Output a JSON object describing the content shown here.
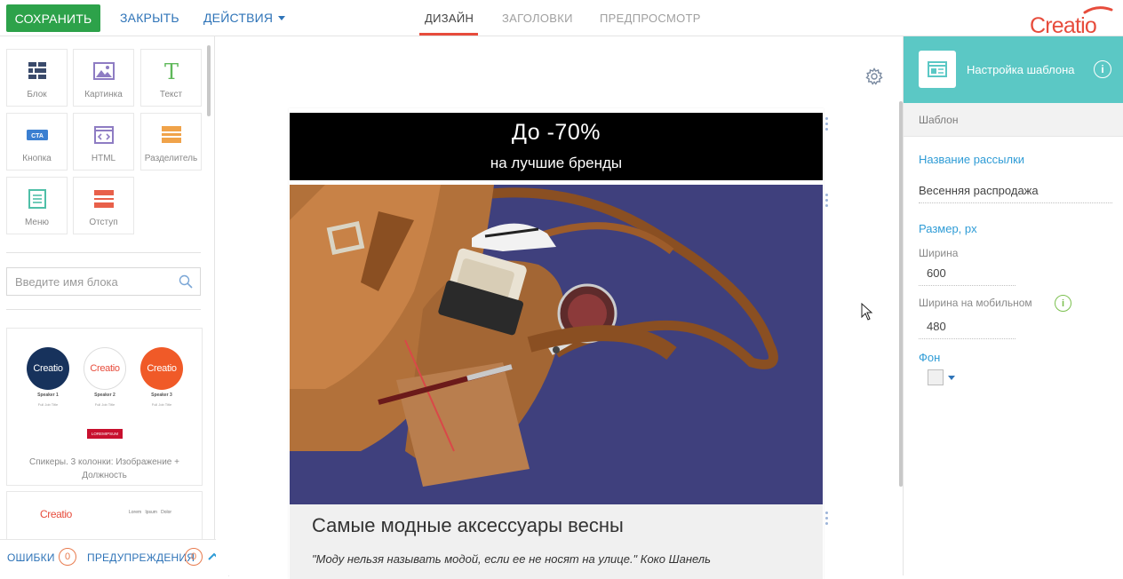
{
  "toolbar": {
    "save_label": "СОХРАНИТЬ",
    "close_label": "ЗАКРЫТЬ",
    "actions_label": "ДЕЙСТВИЯ"
  },
  "tabs": [
    {
      "label": "ДИЗАЙН",
      "active": true
    },
    {
      "label": "ЗАГОЛОВКИ",
      "active": false
    },
    {
      "label": "ПРЕДПРОСМОТР",
      "active": false
    }
  ],
  "brand": {
    "logo_text": "Creatio",
    "accent": "#e74c3c",
    "primary": "#2f74b8",
    "save_green": "#2da24a",
    "panel_teal": "#5bc8c5"
  },
  "blocks": [
    {
      "label": "Блок",
      "icon": "block-icon"
    },
    {
      "label": "Картинка",
      "icon": "image-icon"
    },
    {
      "label": "Текст",
      "icon": "text-icon"
    },
    {
      "label": "Кнопка",
      "icon": "cta-button-icon",
      "badge": "CTA"
    },
    {
      "label": "HTML",
      "icon": "html-icon"
    },
    {
      "label": "Разделитель",
      "icon": "divider-icon"
    },
    {
      "label": "Меню",
      "icon": "menu-icon"
    },
    {
      "label": "Отступ",
      "icon": "spacer-icon"
    }
  ],
  "search": {
    "placeholder": "Введите имя блока"
  },
  "templates": {
    "card1": {
      "speakers": [
        {
          "logo": "Creatio",
          "name": "Speaker 1",
          "title": "Full Job Title"
        },
        {
          "logo": "Creatio",
          "name": "Speaker 2",
          "title": "Full Job Title"
        },
        {
          "logo": "Creatio",
          "name": "Speaker 3",
          "title": "Full Job Title"
        }
      ],
      "badge": "LOREMIPSUM",
      "label": "Спикеры. 3 колонки: Изображение + Должность"
    },
    "card2": {
      "logo": "Creatio",
      "menu": "Lorem   Ipsum   Dolor"
    }
  },
  "status": {
    "errors_label": "ОШИБКИ",
    "errors_count": "0",
    "warnings_label": "ПРЕДУПРЕЖДЕНИЯ",
    "warnings_count": "0"
  },
  "email": {
    "hero_title": "До -70%",
    "hero_subtitle": "на лучшие бренды",
    "text_title": "Самые модные аксессуары весны",
    "text_quote": "\"Моду нельзя называть модой, если ее не носят на улице.\" Коко Шанель"
  },
  "panel": {
    "title": "Настройка шаблона",
    "section": "Шаблон",
    "mailing_name_caption": "Название рассылки",
    "mailing_name": "Весенняя распродажа",
    "size_caption": "Размер, px",
    "width_label": "Ширина",
    "width_value": "600",
    "mobile_width_label": "Ширина на мобильном",
    "mobile_width_value": "480",
    "background_caption": "Фон",
    "background_color": "#f0f0f0"
  }
}
